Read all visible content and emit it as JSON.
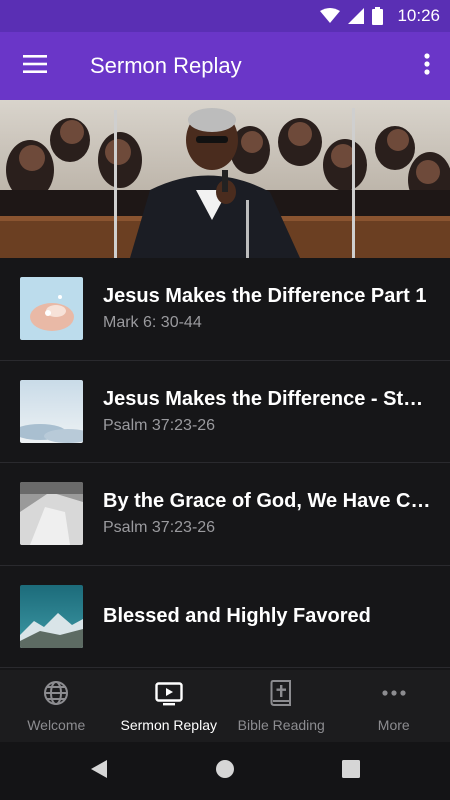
{
  "status_bar": {
    "time": "10:26"
  },
  "app_bar": {
    "title": "Sermon Replay"
  },
  "sermons": [
    {
      "title": "Jesus Makes the Difference Part 1",
      "subtitle": "Mark 6: 30-44"
    },
    {
      "title": "Jesus Makes the Difference - Story...",
      "subtitle": "Psalm 37:23-26"
    },
    {
      "title": "By the Grace of God, We Have Come...",
      "subtitle": "Psalm 37:23-26"
    },
    {
      "title": "Blessed and Highly Favored",
      "subtitle": ""
    }
  ],
  "bottom_nav": [
    {
      "label": "Welcome",
      "icon": "globe-icon",
      "active": false
    },
    {
      "label": "Sermon Replay",
      "icon": "tv-play-icon",
      "active": true
    },
    {
      "label": "Bible Reading",
      "icon": "bible-icon",
      "active": false
    },
    {
      "label": "More",
      "icon": "more-dots-icon",
      "active": false
    }
  ],
  "colors": {
    "status_bar": "#5a2fb4",
    "app_bar": "#6a36c8",
    "background": "#141416"
  }
}
